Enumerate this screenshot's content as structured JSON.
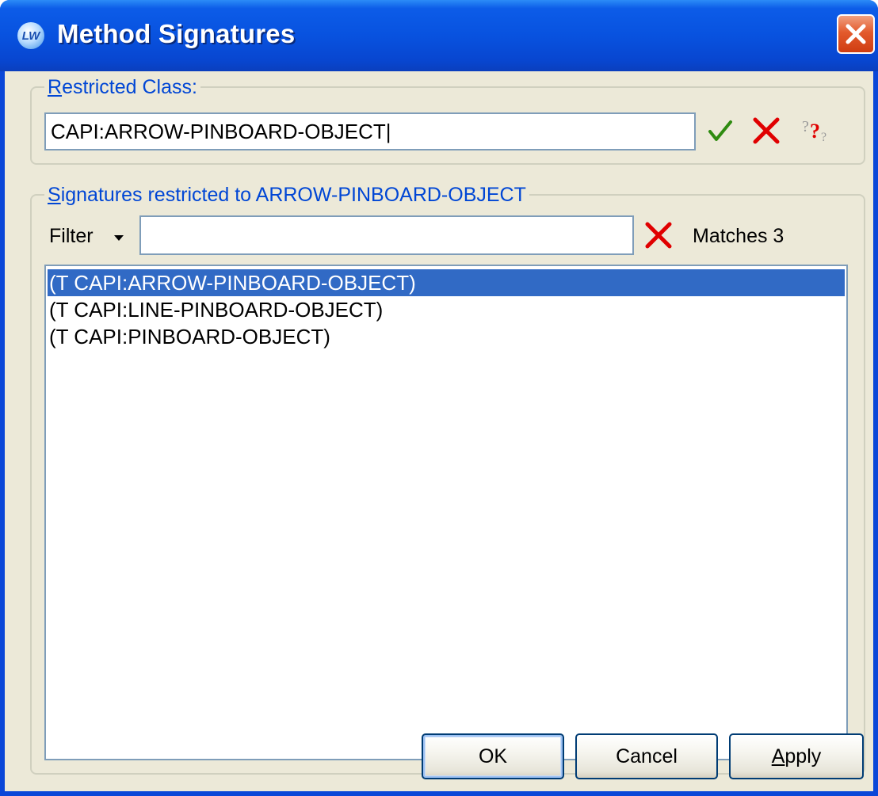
{
  "window": {
    "title": "Method Signatures",
    "app_icon_text": "LW"
  },
  "restricted_class": {
    "label_accel": "R",
    "label_rest": "estricted Class:",
    "value": "CAPI:ARROW-PINBOARD-OBJECT|",
    "icons": [
      "check-icon",
      "cancel-x-icon",
      "help-question-icon"
    ]
  },
  "signatures": {
    "label_accel": "S",
    "label_rest": "ignatures restricted to ARROW-PINBOARD-OBJECT",
    "filter_label": "Filter",
    "filter_value": "",
    "matches_text": "Matches 3",
    "items": [
      "(T CAPI:ARROW-PINBOARD-OBJECT)",
      "(T CAPI:LINE-PINBOARD-OBJECT)",
      "(T CAPI:PINBOARD-OBJECT)"
    ],
    "selected_index": 0
  },
  "buttons": {
    "ok": "OK",
    "cancel": "Cancel",
    "apply_accel": "A",
    "apply_rest": "pply"
  },
  "colors": {
    "title_bar": "#0852df",
    "dialog_bg": "#ece9d8",
    "group_title": "#0046d5",
    "selection": "#316ac5",
    "check": "#2e8b10",
    "cross": "#e00000"
  }
}
